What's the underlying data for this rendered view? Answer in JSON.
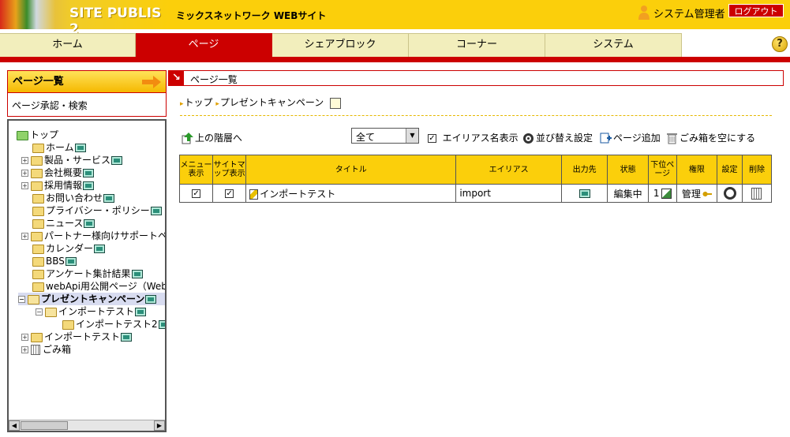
{
  "header": {
    "logo_text": "SITE PUBLIS 2",
    "site_title": "ミックスネットワーク WEBサイト",
    "user_name": "システム管理者",
    "logout_label": "ログアウト"
  },
  "nav": {
    "tabs": [
      {
        "label": "ホーム",
        "active": false
      },
      {
        "label": "ページ",
        "active": true
      },
      {
        "label": "シェアブロック",
        "active": false
      },
      {
        "label": "コーナー",
        "active": false
      },
      {
        "label": "システム",
        "active": false
      }
    ],
    "help_label": "?"
  },
  "sidebar": {
    "title": "ページ一覧",
    "sub_link": "ページ承認・検索",
    "tree": [
      {
        "label": "トップ"
      },
      {
        "label": "ホーム"
      },
      {
        "label": "製品・サービス"
      },
      {
        "label": "会社概要"
      },
      {
        "label": "採用情報"
      },
      {
        "label": "お問い合わせ"
      },
      {
        "label": "プライバシー・ポリシー"
      },
      {
        "label": "ニュース"
      },
      {
        "label": "パートナー様向けサポートペ"
      },
      {
        "label": "カレンダー"
      },
      {
        "label": "BBS"
      },
      {
        "label": "アンケート集計結果"
      },
      {
        "label": "webApi用公開ページ（Webap"
      },
      {
        "label": "プレゼントキャンペーン"
      },
      {
        "label": "インポートテスト"
      },
      {
        "label": "インポートテスト2"
      },
      {
        "label": "インポートテスト"
      },
      {
        "label": "ごみ箱"
      }
    ]
  },
  "main": {
    "title": "ページ一覧",
    "breadcrumb": [
      "トップ",
      "プレゼントキャンペーン"
    ],
    "toolbar": {
      "up_label": "上の階層へ",
      "filter_value": "全て",
      "alias_label": "エイリアス名表示",
      "sort_label": "並び替え設定",
      "add_label": "ページ追加",
      "empty_trash_label": "ごみ箱を空にする"
    },
    "table": {
      "headers": {
        "menu": "メニュー表示",
        "sitemap": "サイトマップ表示",
        "title": "タイトル",
        "alias": "エイリアス",
        "output": "出力先",
        "status": "状態",
        "subpage": "下位ページ",
        "perm": "権限",
        "settings": "設定",
        "delete": "削除"
      },
      "rows": [
        {
          "title": "インポートテスト",
          "alias": "import",
          "status": "編集中",
          "subpage": "1",
          "perm": "管理"
        }
      ]
    }
  }
}
